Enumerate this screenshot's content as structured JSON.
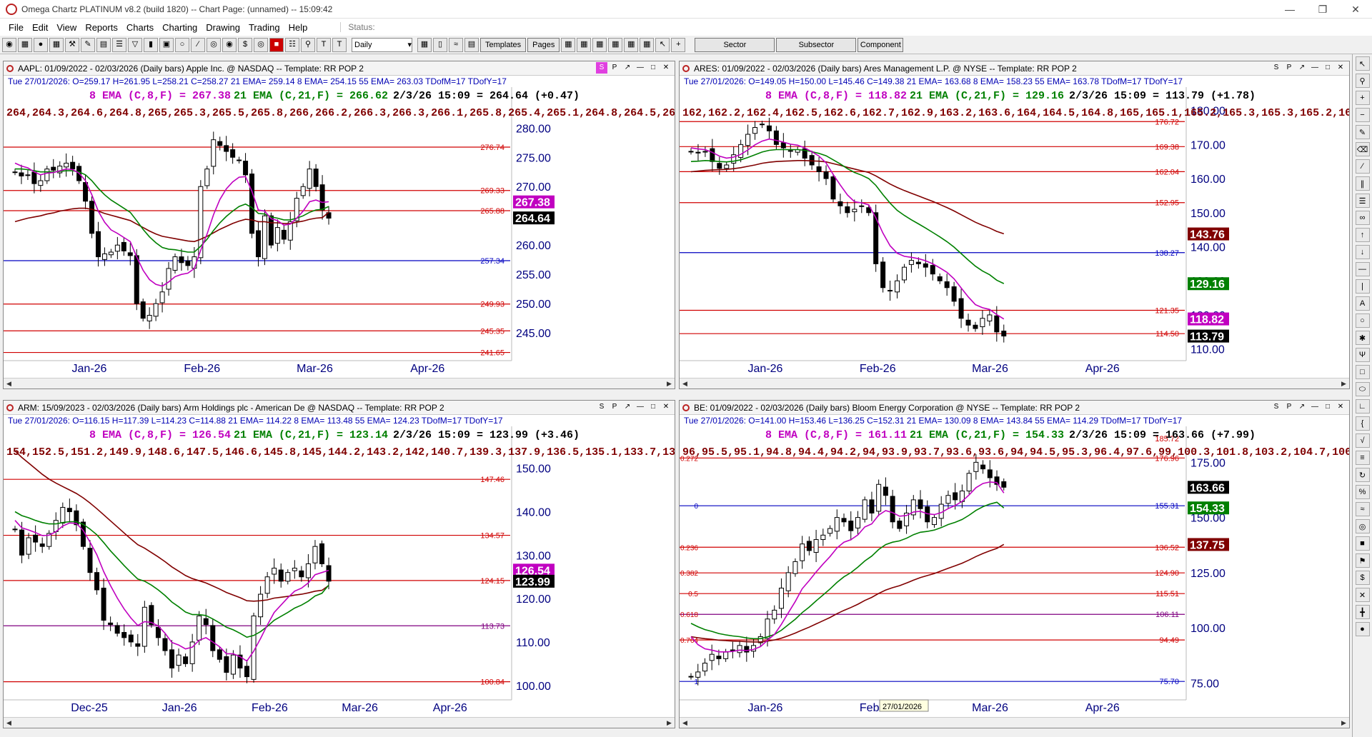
{
  "window": {
    "title": "Omega Chartz PLATINUM v8.2 (build 1820)  --  Chart Page: (unnamed) -- 15:09:42"
  },
  "menu": [
    "File",
    "Edit",
    "View",
    "Reports",
    "Charts",
    "Charting",
    "Drawing",
    "Trading",
    "Help"
  ],
  "status_label": "Status:",
  "toolbar": {
    "period": "Daily",
    "buttons": [
      "Templates",
      "Pages"
    ],
    "wide_buttons": [
      "Sector",
      "Subsector",
      "Component"
    ]
  },
  "charts": [
    {
      "title": "AAPL:  01/09/2022 - 02/03/2026  (Daily bars)   Apple Inc. @ NASDAQ   --  Template: RR POP 2",
      "info": "Tue  27/01/2026:  O=259.17  H=261.95  L=258.21  C=258.27  21 EMA= 259.14  8 EMA= 254.15  55 EMA= 263.03  TDofM=17  TDofY=17",
      "ema_line1": {
        "ema8": "8 EMA (C,8,F) = 267.38",
        "ema21": "21 EMA (C,21,F) = 266.62",
        "last": "2/3/26 15:09 = 264.64 (+0.47)"
      },
      "ema55": [
        264,
        264.3,
        264.6,
        264.8,
        265,
        265.3,
        265.5,
        265.8,
        266,
        266.2,
        266.3,
        266.3,
        266.1,
        265.8,
        265.4,
        265.1,
        264.8,
        264.5,
        264.2,
        263.6,
        263,
        262.4,
        261.9,
        261.5,
        261.3,
        261.1,
        260.9,
        260.7,
        260.6,
        261,
        261.5,
        262.1,
        262.7,
        263.2,
        263.7,
        264.1,
        264.4,
        264.3,
        264,
        264,
        263.8,
        263.8,
        263.7,
        263.7,
        263.9,
        264.1,
        264.4,
        264.6,
        264.7,
        265.6
      ],
      "yaxis": [
        "280.00",
        "275.00",
        "270.00",
        "265.00",
        "260.00",
        "255.00",
        "250.00",
        "245.00"
      ],
      "ymin": 240.5,
      "ymax": 286.5,
      "levels": [
        {
          "label": "276.74",
          "value": 276.74,
          "color": "#d00000"
        },
        {
          "label": "269.33",
          "value": 269.33,
          "color": "#d00000"
        },
        {
          "label": "265.88",
          "value": 265.88,
          "color": "#d00000"
        },
        {
          "label": "257.34",
          "value": 257.34,
          "color": "#0000c0"
        },
        {
          "label": "249.93",
          "value": 249.93,
          "color": "#d00000"
        },
        {
          "label": "245.35",
          "value": 245.35,
          "color": "#d00000"
        },
        {
          "label": "241.65",
          "value": 241.65,
          "color": "#d00000"
        }
      ],
      "tags": [
        {
          "label": "267.38",
          "value": 267.38,
          "bg": "#c000c0"
        },
        {
          "label": "264.64",
          "value": 264.64,
          "bg": "#000000"
        }
      ],
      "xaxis": [
        "Jan-26",
        "Feb-26",
        "Mar-26",
        "Apr-26"
      ],
      "close_path": [
        272.5,
        271.8,
        272,
        270.5,
        271,
        273,
        272.8,
        273.5,
        274,
        273,
        271,
        267.5,
        262,
        258,
        258.5,
        258.8,
        260,
        259,
        258.2,
        250,
        247.5,
        248,
        250,
        252,
        256,
        258,
        257,
        256.5,
        258,
        270,
        273,
        278,
        277,
        276,
        275,
        274.5,
        272,
        262,
        258,
        265,
        260,
        263,
        261,
        264,
        268,
        270,
        273,
        270,
        266,
        264.6
      ],
      "ema8": [
        274,
        273.5,
        273.2,
        272.5,
        272,
        272.3,
        272.4,
        272.7,
        273,
        272.9,
        272.3,
        271,
        268.6,
        265.8,
        263.9,
        262.6,
        262,
        261.3,
        260.6,
        258,
        255.7,
        254.1,
        253.3,
        253,
        253.7,
        254.6,
        255,
        255.2,
        256,
        259.1,
        261.9,
        265.2,
        267.8,
        269.6,
        270.8,
        271.6,
        271.7,
        269.2,
        266,
        265.8,
        264.5,
        264.2,
        263.4,
        263.6,
        264.6,
        265.8,
        267.4,
        267.7,
        267.3,
        267.4
      ],
      "ema21": [
        273,
        273,
        272.9,
        272.7,
        272.5,
        272.5,
        272.5,
        272.6,
        272.7,
        272.7,
        272.5,
        272,
        271,
        269.7,
        268.6,
        267.7,
        267,
        266.3,
        265.6,
        264.2,
        262.7,
        261.4,
        260.4,
        259.6,
        259.3,
        259.2,
        259,
        258.8,
        258.8,
        259.8,
        261,
        262.5,
        263.8,
        264.9,
        265.8,
        266.6,
        267,
        266.4,
        265.4,
        265.3,
        264.8,
        264.6,
        264.3,
        264.3,
        264.6,
        265,
        265.6,
        266,
        266.1,
        266.6
      ]
    },
    {
      "title": "ARES:  01/09/2022 - 02/03/2026  (Daily bars)   Ares Management L.P. @ NYSE   --  Template: RR POP 2",
      "info": "Tue  27/01/2026:  O=149.05  H=150.00  L=145.46  C=149.38  21 EMA= 163.68  8 EMA= 158.23  55 EMA= 163.78  TDofM=17  TDofY=17",
      "ema_line1": {
        "ema8": "8 EMA (C,8,F) = 118.82",
        "ema21": "21 EMA (C,21,F) = 129.16",
        "last": "2/3/26 15:09 = 113.79 (+1.78)"
      },
      "ema55": [
        162,
        162.2,
        162.4,
        162.5,
        162.6,
        162.7,
        162.9,
        163.2,
        163.6,
        164,
        164.5,
        164.8,
        165,
        165.1,
        165.2,
        165.3,
        165.3,
        165.2,
        165.1,
        164.9,
        164.4,
        163.9,
        163.3,
        162.8,
        162.3,
        161.8,
        160.8,
        159.6,
        158.4,
        157.4,
        156.5,
        155.7,
        154.9,
        154.1,
        153.3,
        152.4,
        151.5,
        150.5,
        149.4,
        148.3,
        147.2,
        146.3,
        145.5,
        144.5,
        143.8
      ],
      "yaxis": [
        "180.00",
        "170.00",
        "160.00",
        "150.00",
        "140.00",
        "130.00",
        "120.00",
        "110.00"
      ],
      "ymin": 107,
      "ymax": 186,
      "levels": [
        {
          "label": "176.72",
          "value": 176.72,
          "color": "#d00000"
        },
        {
          "label": "169.38",
          "value": 169.38,
          "color": "#d00000"
        },
        {
          "label": "162.04",
          "value": 162.04,
          "color": "#d00000"
        },
        {
          "label": "152.95",
          "value": 152.95,
          "color": "#d00000"
        },
        {
          "label": "138.27",
          "value": 138.27,
          "color": "#0000c0"
        },
        {
          "label": "121.35",
          "value": 121.35,
          "color": "#d00000"
        },
        {
          "label": "114.50",
          "value": 114.5,
          "color": "#d00000"
        }
      ],
      "tags": [
        {
          "label": "143.76",
          "value": 143.76,
          "bg": "#800000"
        },
        {
          "label": "129.16",
          "value": 129.16,
          "bg": "#008000"
        },
        {
          "label": "118.82",
          "value": 118.82,
          "bg": "#c000c0"
        },
        {
          "label": "113.79",
          "value": 113.79,
          "bg": "#000000"
        }
      ],
      "xaxis": [
        "Jan-26",
        "Feb-26",
        "Mar-26",
        "Apr-26"
      ],
      "close_path": [
        168,
        167.5,
        168,
        165,
        163,
        164,
        167,
        170,
        173,
        175,
        176,
        174,
        170,
        169,
        168,
        168.5,
        166,
        164,
        162,
        160,
        154,
        152,
        150,
        151,
        152,
        150,
        135,
        128,
        127,
        130,
        134,
        136,
        135,
        134,
        132,
        130,
        128,
        124,
        119,
        117,
        116,
        119,
        120,
        115,
        113.8
      ],
      "ema8": [
        169,
        168.7,
        168.5,
        167.7,
        166.6,
        166,
        166.3,
        167.1,
        168.4,
        169.9,
        171,
        171.6,
        171.2,
        170.7,
        170.1,
        169.8,
        169,
        167.9,
        166.6,
        164.6,
        161.2,
        158.1,
        155.2,
        153.2,
        152.9,
        152.3,
        148.5,
        144,
        140.3,
        138.1,
        137.2,
        136.9,
        136.5,
        135.9,
        135,
        133.8,
        132.5,
        130.6,
        127.9,
        125.3,
        123,
        122.1,
        121.6,
        120.1,
        118.8
      ],
      "ema21": [
        165,
        165.1,
        165.3,
        165.2,
        165,
        164.9,
        165.1,
        165.5,
        166.2,
        167,
        167.8,
        168.3,
        168.5,
        168.5,
        168.5,
        168.5,
        168.3,
        167.9,
        167.4,
        166.7,
        165.5,
        164.3,
        162.9,
        161.8,
        161,
        160,
        158,
        155.3,
        152.8,
        150.7,
        149.2,
        147.9,
        146.7,
        145.5,
        144.2,
        142.9,
        141.5,
        139.9,
        138,
        136.1,
        134.3,
        132.9,
        131.8,
        130.2,
        129.2
      ]
    },
    {
      "title": "ARM:  15/09/2023 - 02/03/2026  (Daily bars)   Arm Holdings plc - American De @ NASDAQ   --  Template: RR POP 2",
      "info": "Tue  27/01/2026:  O=116.15  H=117.39  L=114.23  C=114.88  21 EMA= 114.22  8 EMA= 113.48  55 EMA= 124.23  TDofM=17  TDofY=17",
      "ema_line1": {
        "ema8": "8 EMA (C,8,F) = 126.54",
        "ema21": "21 EMA (C,21,F) = 123.14",
        "last": "2/3/26 15:09 = 123.99 (+3.46)"
      },
      "ema55": [
        154,
        152.5,
        151.2,
        149.9,
        148.6,
        147.5,
        146.6,
        145.8,
        145,
        144.2,
        143.2,
        142,
        140.7,
        139.3,
        137.9,
        136.5,
        135.1,
        133.7,
        132.4,
        131.6,
        130.6,
        129.6,
        128.5,
        127.3,
        126.3,
        125.3,
        124.6,
        124.1,
        123.6,
        122.9,
        122.2,
        121.4,
        120.8,
        120.2,
        119.5,
        119.4,
        119.5,
        119.7,
        120.1,
        120.3,
        120.5,
        120.8,
        121,
        121.3,
        121.7,
        121.9,
        123
      ],
      "yaxis": [
        "150.00",
        "140.00",
        "130.00",
        "120.00",
        "110.00",
        "100.00"
      ],
      "ymin": 97,
      "ymax": 159,
      "levels": [
        {
          "label": "147.46",
          "value": 147.46,
          "color": "#d00000"
        },
        {
          "label": "134.57",
          "value": 134.57,
          "color": "#d00000"
        },
        {
          "label": "124.15",
          "value": 124.15,
          "color": "#d00000"
        },
        {
          "label": "113.73",
          "value": 113.73,
          "color": "#800080"
        },
        {
          "label": "100.84",
          "value": 100.84,
          "color": "#d00000"
        }
      ],
      "tags": [
        {
          "label": "126.54",
          "value": 126.54,
          "bg": "#c000c0"
        },
        {
          "label": "123.99",
          "value": 123.99,
          "bg": "#000000"
        }
      ],
      "xaxis": [
        "Dec-25",
        "Jan-26",
        "Feb-26",
        "Mar-26",
        "Apr-26"
      ],
      "close_path": [
        136,
        130,
        134,
        133,
        132,
        135,
        138,
        141,
        140,
        137,
        132,
        126,
        122,
        115,
        114,
        112,
        111,
        110,
        109,
        118,
        114,
        111,
        108,
        104,
        107,
        105,
        110,
        116,
        114,
        108,
        106,
        103,
        107,
        104,
        102,
        116,
        121,
        125,
        127,
        124,
        126,
        127,
        125,
        128,
        132,
        128,
        124
      ],
      "ema8": [
        138,
        136.3,
        135.8,
        135.2,
        134.5,
        134.6,
        135.4,
        136.7,
        137.4,
        137.3,
        135.7,
        133,
        130.1,
        126.2,
        123,
        120.1,
        117.6,
        115.5,
        113.8,
        114.7,
        114.5,
        113.7,
        112,
        109.9,
        109.3,
        108.4,
        108.8,
        110.4,
        111,
        110,
        108.9,
        107.3,
        107.3,
        106.6,
        105.6,
        107.9,
        110.8,
        113.9,
        116.8,
        118.5,
        120.2,
        121.7,
        122.4,
        123.6,
        125.5,
        126,
        126.5
      ],
      "ema21": [
        140,
        139.1,
        138.6,
        138,
        137.5,
        137.2,
        137.2,
        137.5,
        137.7,
        137.7,
        137.1,
        136,
        134.7,
        132.9,
        131,
        129.3,
        127.6,
        126,
        124.5,
        124,
        123.1,
        122,
        120.7,
        119.2,
        118.1,
        116.9,
        116.3,
        116.3,
        116.1,
        115.3,
        114.4,
        113.4,
        112.8,
        112,
        111.1,
        111.5,
        112.4,
        113.6,
        115,
        115.9,
        116.8,
        117.8,
        118.5,
        119.4,
        120.6,
        121.2,
        123.1
      ]
    },
    {
      "title": "BE:  01/09/2022 - 02/03/2026  (Daily bars)   Bloom Energy Corporation @ NYSE   --  Template: RR POP 2",
      "info": "Tue  27/01/2026:  O=141.00  H=153.46  L=136.25  C=152.31  21 EMA= 130.09  8 EMA= 143.84  55 EMA= 114.29  TDofM=17  TDofY=17",
      "ema_line1": {
        "ema8": "8 EMA (C,8,F) = 161.11",
        "ema21": "21 EMA (C,21,F) = 154.33",
        "last": "2/3/26 15:09 = 163.66 (+7.99)"
      },
      "ema55": [
        96,
        95.5,
        95.1,
        94.8,
        94.4,
        94.2,
        94,
        93.9,
        93.7,
        93.6,
        93.6,
        94,
        94.5,
        95.3,
        96.4,
        97.6,
        99,
        100.3,
        101.8,
        103.2,
        104.7,
        106.4,
        107.9,
        109.2,
        110.7,
        112.4,
        113.8,
        115.6,
        117.1,
        118.2,
        119.1,
        120.3,
        121.6,
        122.8,
        123.7,
        124.6,
        125.8,
        127,
        128.1,
        129.3,
        130.7,
        132.3,
        133.7,
        134.9,
        136,
        137.8
      ],
      "yaxis": [
        "175.00",
        "150.00",
        "125.00",
        "100.00",
        "75.00"
      ],
      "ymin": 68,
      "ymax": 190,
      "levels": [
        {
          "label": "176.96",
          "value": 176.96,
          "color": "#d00000"
        },
        {
          "label": "155.31",
          "value": 155.31,
          "color": "#0000c0"
        },
        {
          "label": "136.52",
          "value": 136.52,
          "color": "#d00000"
        },
        {
          "label": "124.90",
          "value": 124.9,
          "color": "#d00000"
        },
        {
          "label": "115.51",
          "value": 115.51,
          "color": "#d00000"
        },
        {
          "label": "106.11",
          "value": 106.11,
          "color": "#800080"
        },
        {
          "label": "94.49",
          "value": 94.49,
          "color": "#d00000"
        },
        {
          "label": "75.70",
          "value": 75.7,
          "color": "#0000c0"
        }
      ],
      "fib_labels": [
        {
          "label": "185.72",
          "value": 185.72
        },
        {
          "label": "0.272",
          "value": 176.96
        },
        {
          "label": "0",
          "value": 155.31
        },
        {
          "label": "0.236",
          "value": 136.52
        },
        {
          "label": "0.382",
          "value": 124.9
        },
        {
          "label": "0.5",
          "value": 115.51
        },
        {
          "label": "0.618",
          "value": 106.11
        },
        {
          "label": "0.764",
          "value": 94.49
        },
        {
          "label": "1",
          "value": 75.7
        }
      ],
      "tags": [
        {
          "label": "163.66",
          "value": 163.66,
          "bg": "#000000"
        },
        {
          "label": "154.33",
          "value": 154.33,
          "bg": "#008000"
        },
        {
          "label": "137.75",
          "value": 137.75,
          "bg": "#800000"
        }
      ],
      "xaxis": [
        "Jan-26",
        "Feb-26",
        "Mar-26",
        "Apr-26"
      ],
      "cursor_date": "27/01/2026",
      "close_path": [
        78,
        80,
        84,
        88,
        86,
        89,
        90,
        92,
        89,
        92,
        96,
        104,
        108,
        118,
        125,
        130,
        138,
        135,
        140,
        142,
        145,
        150,
        148,
        144,
        150,
        158,
        152,
        165,
        160,
        148,
        145,
        152,
        158,
        154,
        148,
        150,
        156,
        160,
        158,
        162,
        170,
        175,
        172,
        168,
        165,
        163.7
      ],
      "ema8": [
        96,
        92.4,
        90.5,
        89.9,
        89.1,
        89.1,
        89.3,
        89.9,
        89.7,
        90.2,
        91.5,
        94.3,
        97,
        101.6,
        106.8,
        111.9,
        117.7,
        121.4,
        125.3,
        128.9,
        132.3,
        136.2,
        138.8,
        139.9,
        142.1,
        145.7,
        147.1,
        151.1,
        153.1,
        152.2,
        150.6,
        150.9,
        152.5,
        152.8,
        151.7,
        151.3,
        152.2,
        154,
        155.4,
        157.3,
        160.2,
        163.5,
        165.4,
        166.1,
        165.8,
        161.1
      ],
      "ema21": [
        102,
        100.5,
        99.2,
        98.4,
        97.4,
        96.8,
        96.3,
        96,
        95.4,
        95.1,
        95.1,
        95.9,
        97,
        98.9,
        101.4,
        103.9,
        106.9,
        109.4,
        112.2,
        114.9,
        117.6,
        120.6,
        123.1,
        125,
        127.5,
        130.3,
        132.5,
        135.5,
        137.7,
        138.8,
        139.4,
        140.6,
        142.2,
        143.3,
        143.7,
        144.3,
        145.4,
        146.8,
        147.8,
        149.1,
        151,
        153.2,
        154.9,
        156.1,
        156.9,
        154.3
      ]
    }
  ],
  "colors": {
    "ema8": "#c000c0",
    "ema21": "#008000",
    "ema55": "#800000",
    "info": "#0000b4",
    "window_icon": "#b22222"
  }
}
